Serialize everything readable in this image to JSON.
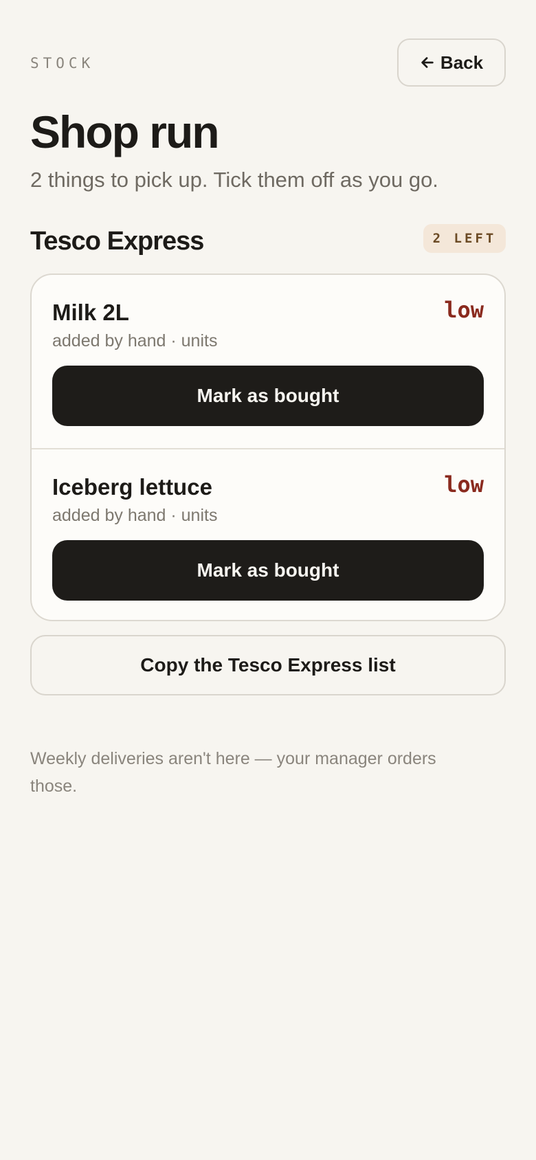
{
  "header": {
    "eyebrow": "STOCK",
    "back_label": "Back",
    "back_icon": "arrow-left-icon"
  },
  "page": {
    "title": "Shop run",
    "subtitle": "2 things to pick up. Tick them off as you go."
  },
  "store": {
    "name": "Tesco Express",
    "remaining_badge": "2 LEFT"
  },
  "items": [
    {
      "name": "Milk 2L",
      "status": "low",
      "meta": "added by hand · units",
      "action_label": "Mark as bought"
    },
    {
      "name": "Iceberg lettuce",
      "status": "low",
      "meta": "added by hand · units",
      "action_label": "Mark as bought"
    }
  ],
  "copy_button_label": "Copy the Tesco Express list",
  "footnote": "Weekly deliveries aren't here — your manager orders those.",
  "colors": {
    "background": "#f7f5f0",
    "primary_button": "#1e1c19",
    "status_low": "#8a2a1e",
    "badge_bg": "#f4e7d9",
    "badge_text": "#6b4a24"
  }
}
